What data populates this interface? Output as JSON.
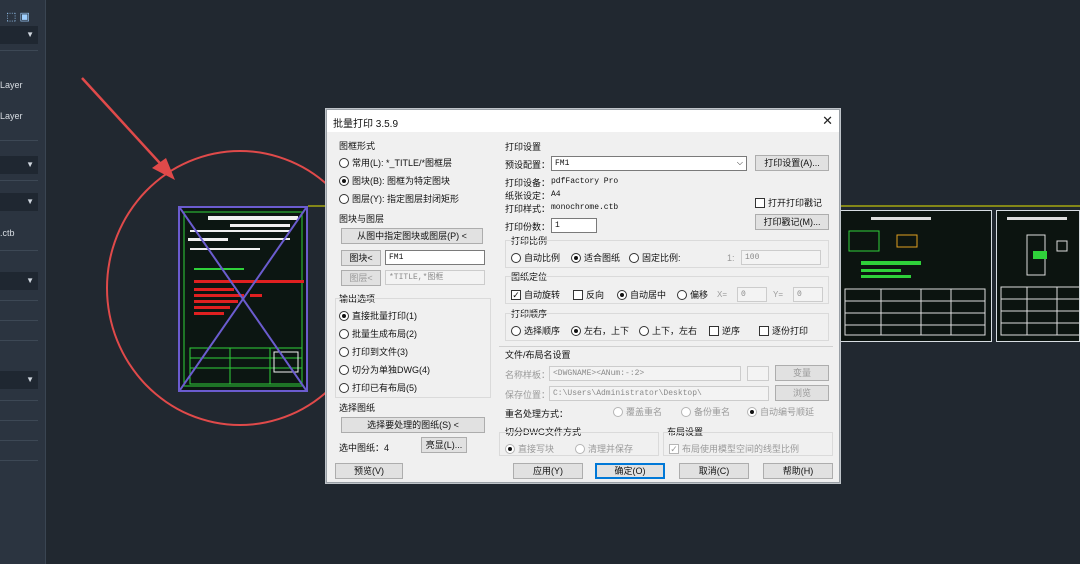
{
  "left_panel": {
    "rows": [
      "",
      "",
      "Layer",
      "Layer",
      "",
      "",
      ".ctb",
      "",
      "",
      ""
    ],
    "layer1": "Layer",
    "layer2": "Layer",
    "ctb": ".ctb"
  },
  "dialog": {
    "title": "批量打印 3.5.9",
    "close": "✕",
    "frame_form": {
      "title": "图框形式",
      "options": [
        "常用(L): *_TITLE/*图框层",
        "图块(B): 图框为特定图块",
        "图层(Y): 指定图层封闭矩形"
      ],
      "selected": 1
    },
    "block_layer": {
      "title": "图块与图层",
      "pick_button": "从图中指定图块或图层(P) <",
      "block_button": "图块<",
      "block_value": "FM1",
      "layer_button": "图层<",
      "layer_value": "*TITLE,*图框"
    },
    "output": {
      "title": "输出选项",
      "options": [
        "直接批量打印(1)",
        "批量生成布局(2)",
        "打印到文件(3)",
        "切分为单独DWG(4)",
        "打印已有布局(5)"
      ],
      "selected": 0
    },
    "select_drawings": {
      "title": "选择图纸",
      "button": "选择要处理的图纸(S) <",
      "count_label": "选中图纸：4",
      "highlight_button": "亮显(L)..."
    },
    "print_settings": {
      "title": "打印设置",
      "preset_label": "预设配置：",
      "preset_value": "FM1",
      "settings_button": "打印设置(A)...",
      "device_label": "打印设备：",
      "device_value": "pdfFactory Pro",
      "paper_label": "纸张设定：",
      "paper_value": "A4",
      "style_label": "打印样式：",
      "style_value": "monochrome.ctb",
      "copies_label": "打印份数：",
      "copies_value": "1",
      "open_log": "打开打印戳记",
      "log_button": "打印戳记(M)..."
    },
    "scale": {
      "title": "打印比例",
      "options": [
        "自动比例",
        "适合图纸",
        "固定比例:"
      ],
      "selected": 1,
      "ratio_left": "1:",
      "ratio_value": "100"
    },
    "position": {
      "title": "图纸定位",
      "auto_rotate": "自动旋转",
      "reverse": "反向",
      "auto_center": "自动居中",
      "offset": "偏移",
      "x_label": "X=",
      "x_value": "0",
      "y_label": "Y=",
      "y_value": "0"
    },
    "order": {
      "title": "打印顺序",
      "options": [
        "选择顺序",
        "左右，上下",
        "上下，左右"
      ],
      "selected": 1,
      "reverse": "逆序",
      "page_by_page": "逐份打印"
    },
    "file_layout": {
      "title": "文件/布局名设置",
      "name_label": "名称样板：",
      "name_value": "<DWGNAME><ANum:-:2>",
      "change_button": "变量",
      "save_label": "保存位置：",
      "save_value": "C:\\Users\\Administrator\\Desktop\\",
      "browse_button": "浏览",
      "rename_label": "重名处理方式：",
      "rename_options": [
        "覆盖重名",
        "备份重名",
        "自动编号顺延"
      ],
      "rename_selected": 2
    },
    "split_dwg": {
      "title": "切分DWG文件方式",
      "options": [
        "直接写块",
        "清理并保存"
      ],
      "selected": 0
    },
    "layout_settings": {
      "title": "布局设置",
      "check": "布局使用模型空间的线型比例"
    },
    "footer": {
      "preview": "预览(V)",
      "apply": "应用(Y)",
      "ok": "确定(O)",
      "cancel": "取消(C)",
      "help": "帮助(H)"
    }
  },
  "colors": {
    "background": "#212830",
    "annotation_red": "#e04a4a",
    "frame_purple": "#6b5ccf",
    "cad_green": "#2fd13a",
    "cad_red": "#e02020"
  }
}
